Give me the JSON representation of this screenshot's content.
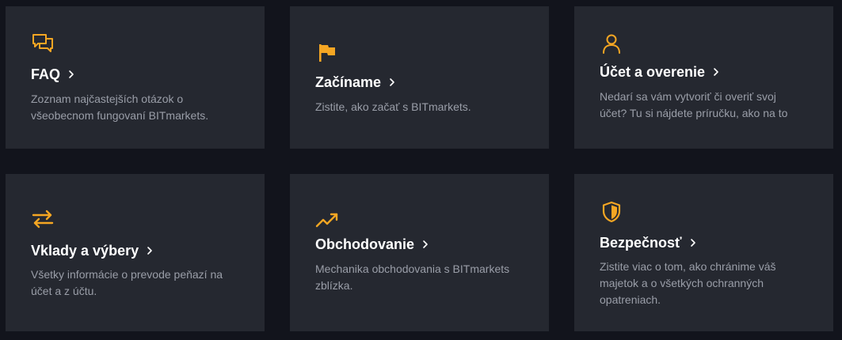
{
  "colors": {
    "background": "#12141c",
    "card": "#252830",
    "accent": "#f5a623",
    "title": "#ffffff",
    "description": "#9a9ea8"
  },
  "cards": [
    {
      "icon": "chat-bubbles-icon",
      "title": "FAQ",
      "description": "Zoznam najčastejších otázok o všeobecnom fungovaní BITmarkets."
    },
    {
      "icon": "flag-icon",
      "title": "Začíname",
      "description": "Zistite, ako začať s BITmarkets."
    },
    {
      "icon": "user-icon",
      "title": "Účet a overenie",
      "description": "Nedarí sa vám vytvoriť či overiť svoj účet? Tu si nájdete príručku, ako na to"
    },
    {
      "icon": "transfer-arrows-icon",
      "title": "Vklady a výbery",
      "description": "Všetky informácie o prevode peňazí na účet a z účtu."
    },
    {
      "icon": "trending-up-icon",
      "title": "Obchodovanie",
      "description": "Mechanika obchodovania s BITmarkets zblízka."
    },
    {
      "icon": "shield-icon",
      "title": "Bezpečnosť",
      "description": "Zistite viac o tom, ako chránime váš majetok a o všetkých ochranných opatreniach."
    }
  ]
}
